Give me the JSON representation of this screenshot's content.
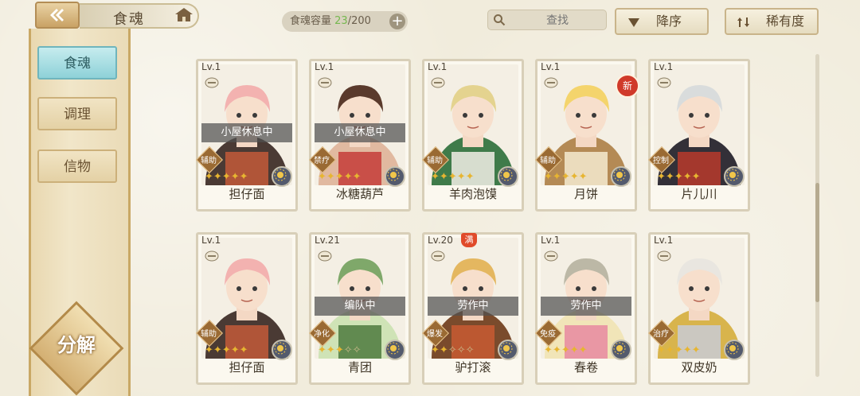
{
  "header": {
    "title": "食魂",
    "capacity_label": "食魂容量",
    "capacity_current": "23",
    "capacity_max": "/200",
    "add_label": "+",
    "search_placeholder": "查找",
    "sort_desc_label": "降序",
    "sort_rarity_label": "稀有度"
  },
  "sidebar": {
    "items": [
      {
        "label": "食魂",
        "active": true
      },
      {
        "label": "调理",
        "active": false
      },
      {
        "label": "信物",
        "active": false
      }
    ],
    "decompose_label": "分解"
  },
  "colors": {
    "accent": "#8ed1d8",
    "panel": "#eadbb7",
    "capacity_green": "#75b84e",
    "status_overlay": "#505050",
    "new_badge": "#d03a2a"
  },
  "cards": [
    {
      "level": "Lv.1",
      "name": "担仔面",
      "status": "小屋休息中",
      "role": "辅助",
      "stars": 5,
      "palette": [
        "#f3b2b0",
        "#4a3a34",
        "#c25b3a"
      ],
      "badge": ""
    },
    {
      "level": "Lv.1",
      "name": "冰糖葫芦",
      "status": "小屋休息中",
      "role": "禁疗",
      "stars": 5,
      "palette": [
        "#5a3a2c",
        "#e1b9a0",
        "#c43c38"
      ],
      "badge": ""
    },
    {
      "level": "Lv.1",
      "name": "羊肉泡馍",
      "status": "",
      "role": "辅助",
      "stars": 5,
      "palette": [
        "#e4d38f",
        "#3f7b4a",
        "#f2eee6"
      ],
      "badge": ""
    },
    {
      "level": "Lv.1",
      "name": "月饼",
      "status": "",
      "role": "辅助",
      "stars": 5,
      "palette": [
        "#f4d46c",
        "#b48a55",
        "#f5ead0"
      ],
      "badge": "新"
    },
    {
      "level": "Lv.1",
      "name": "片儿川",
      "status": "",
      "role": "控制",
      "stars": 5,
      "palette": [
        "#d9dcdc",
        "#333038",
        "#b83a2c"
      ],
      "badge": ""
    },
    {
      "level": "Lv.1",
      "name": "担仔面",
      "status": "",
      "role": "辅助",
      "stars": 5,
      "palette": [
        "#f3b2b0",
        "#4a3a34",
        "#c25b3a"
      ],
      "badge": ""
    },
    {
      "level": "Lv.21",
      "name": "青团",
      "status": "编队中",
      "role": "净化",
      "stars": 3,
      "palette": [
        "#7fa86a",
        "#cfe3b6",
        "#4d7a3e"
      ],
      "badge": ""
    },
    {
      "level": "Lv.20",
      "name": "驴打滚",
      "status": "劳作中",
      "role": "爆发",
      "stars": 2,
      "palette": [
        "#e4b760",
        "#7a4b2c",
        "#c85a32"
      ],
      "badge": "满"
    },
    {
      "level": "Lv.1",
      "name": "春卷",
      "status": "劳作中",
      "role": "免疫",
      "stars": 5,
      "palette": [
        "#bcb8a6",
        "#f1e5b8",
        "#e88aa0"
      ],
      "badge": ""
    },
    {
      "level": "Lv.1",
      "name": "双皮奶",
      "status": "",
      "role": "治疗",
      "stars": 5,
      "palette": [
        "#e9e6e0",
        "#d8b44c",
        "#c9cbd6"
      ],
      "badge": ""
    }
  ]
}
